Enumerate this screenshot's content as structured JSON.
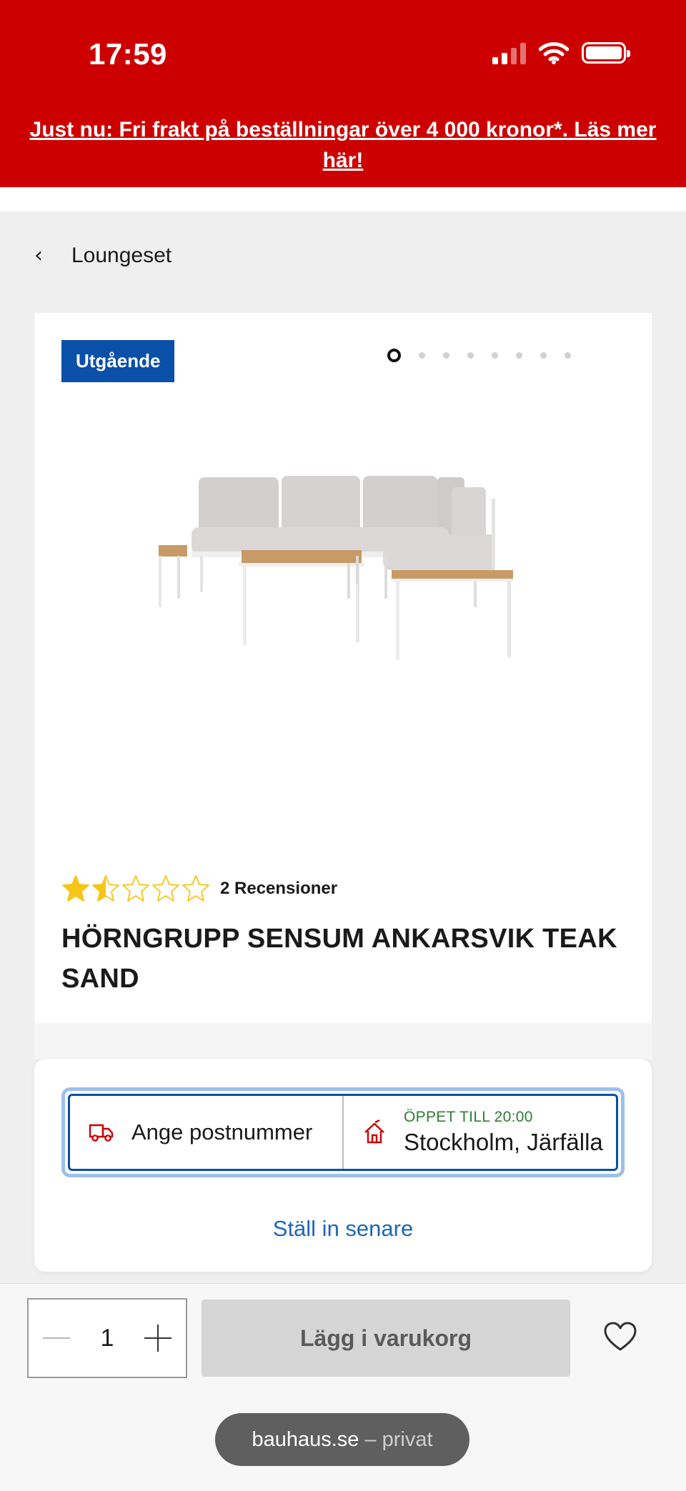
{
  "status_bar": {
    "time": "17:59"
  },
  "banner": {
    "text": "Just nu: Fri frakt på beställningar över 4 000 kronor*. Läs mer här!"
  },
  "nav": {
    "back_label": "Loungeset"
  },
  "product": {
    "badge": "Utgående",
    "carousel": {
      "total": 8,
      "active_index": 0
    },
    "rating": {
      "value": 1.5,
      "max": 5
    },
    "reviews_text": "2 Recensioner",
    "title": "HÖRNGRUPP SENSUM ANKARSVIK TEAK SAND"
  },
  "delivery": {
    "postcode_label": "Ange postnummer",
    "store_open": "ÖPPET TILL 20:00",
    "store_name": "Stockholm, Järfälla",
    "later_link": "Ställ in senare"
  },
  "cart_bar": {
    "quantity": "1",
    "add_to_cart": "Lägg i varukorg"
  },
  "browser": {
    "domain": "bauhaus.se",
    "mode": "– privat"
  },
  "colors": {
    "brand_red": "#cc0000",
    "badge_blue": "#0a4fa8",
    "link_blue": "#1d66b5",
    "open_green": "#2e7d32",
    "star_yellow": "#f5c518"
  },
  "icons": {
    "back": "chevron-left-icon",
    "truck": "truck-icon",
    "store": "store-icon",
    "favorite": "heart-icon"
  }
}
